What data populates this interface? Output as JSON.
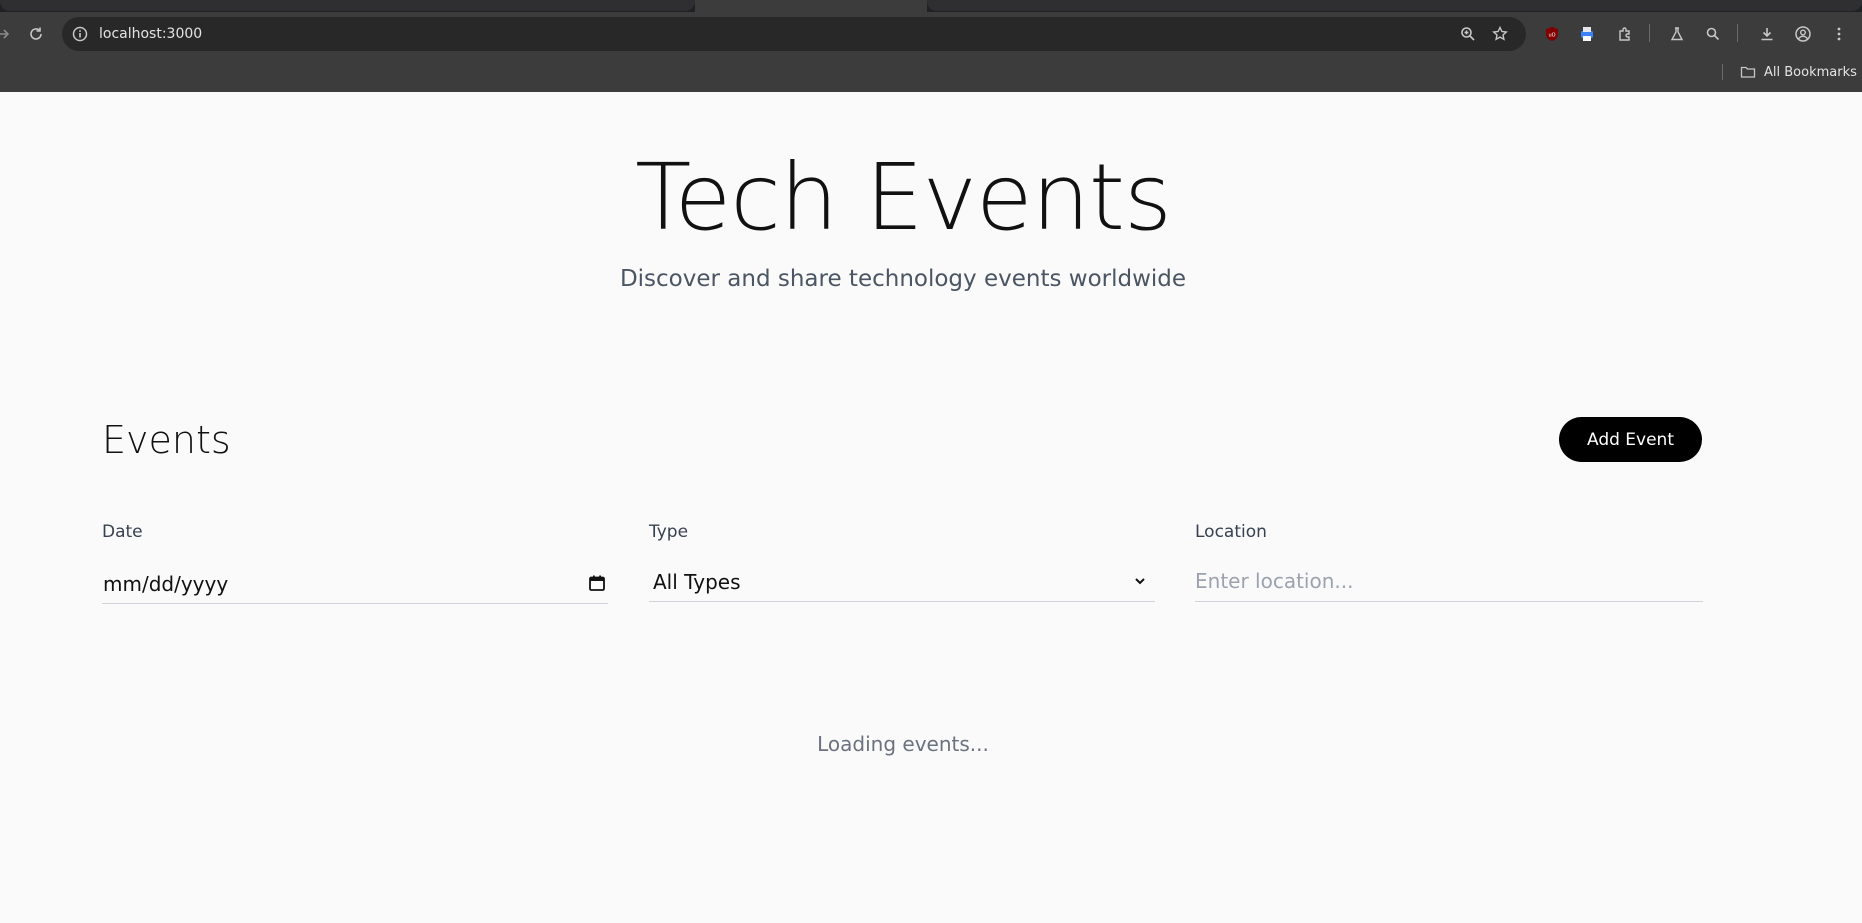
{
  "browser": {
    "url": "localhost:3000",
    "bookmarks_label": "All Bookmarks"
  },
  "hero": {
    "title": "Tech Events",
    "subtitle": "Discover and share technology events worldwide"
  },
  "events": {
    "heading": "Events",
    "add_button": "Add Event"
  },
  "filters": {
    "date": {
      "label": "Date",
      "value": "mm/dd/yyyy"
    },
    "type": {
      "label": "Type",
      "value": "All Types"
    },
    "location": {
      "label": "Location",
      "placeholder": "Enter location..."
    }
  },
  "status": {
    "loading": "Loading events..."
  }
}
